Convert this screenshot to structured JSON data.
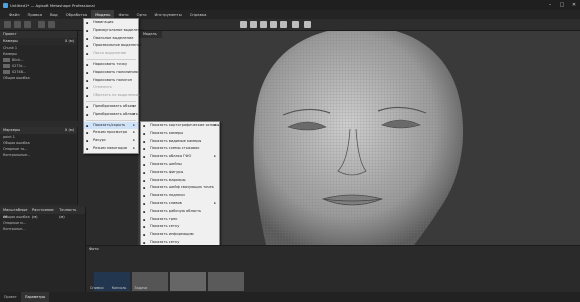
{
  "window": {
    "title": "Untitled1* — Agisoft Metashape Professional"
  },
  "menubar": [
    "Файл",
    "Правка",
    "Вид",
    "Обработка",
    "Модель",
    "Фото",
    "Орто",
    "Инструменты",
    "Справка"
  ],
  "active_menu": "Модель",
  "left_panels": {
    "workspace": {
      "title": "Проект",
      "col1": "Камеры",
      "col2": "X (м)",
      "rows": [
        "Chunk 1",
        "Камеры",
        "Blink...",
        "0273c...",
        "0274B..."
      ],
      "footer": "Общая ошибка"
    },
    "markers": {
      "title": "Маркеры",
      "col2": "X (м)",
      "rows": [
        "point 1",
        "Общая ошибка",
        "Опорные то...",
        "Контрольные..."
      ]
    },
    "scalebars": {
      "col1": "Масштабные ли",
      "col2": "Расстояние (м)",
      "col3": "Точность (м)",
      "rows": [
        "Общая ошибка",
        "Опорные м...",
        "Контрольн..."
      ]
    }
  },
  "viewport": {
    "tab": "Модель"
  },
  "model_menu": {
    "items": [
      {
        "label": "Навигация",
        "type": "item"
      },
      {
        "label": "Прямоугольное выделение",
        "type": "item"
      },
      {
        "label": "Овальное выделение",
        "type": "item"
      },
      {
        "label": "Произвольное выделение",
        "type": "item"
      },
      {
        "label": "Лассо выделение",
        "type": "disabled"
      },
      {
        "type": "sep"
      },
      {
        "label": "Нарисовать точку",
        "type": "item"
      },
      {
        "label": "Нарисовать полилинию",
        "type": "item"
      },
      {
        "label": "Нарисовать полигон",
        "type": "item"
      },
      {
        "label": "Отменить",
        "type": "disabled"
      },
      {
        "label": "Обрезать по выделению",
        "type": "disabled"
      },
      {
        "type": "sep"
      },
      {
        "label": "Преобразовать объект",
        "type": "sub"
      },
      {
        "label": "Преобразовать область",
        "type": "sub"
      },
      {
        "type": "sep"
      },
      {
        "label": "Показать/скрыть",
        "type": "sub",
        "highlight": true
      },
      {
        "label": "Режим просмотра",
        "type": "sub"
      },
      {
        "label": "Ракурс",
        "type": "sub"
      },
      {
        "label": "Режим навигации",
        "type": "sub"
      }
    ]
  },
  "show_submenu": {
    "items": [
      {
        "label": "Показать картографические основы",
        "type": "sub"
      },
      {
        "label": "Показать камеры",
        "type": "item"
      },
      {
        "label": "Показать видимые камеры",
        "type": "item"
      },
      {
        "label": "Показать схемы стыковок",
        "type": "item"
      },
      {
        "label": "Показать облака ГФО",
        "type": "sub"
      },
      {
        "label": "Показать шейпы",
        "type": "item"
      },
      {
        "label": "Показать фигуры",
        "type": "item"
      },
      {
        "label": "Показать маркеры",
        "type": "item"
      },
      {
        "label": "Показать шейф связующих точек",
        "type": "item"
      },
      {
        "label": "Показать подписи",
        "type": "item"
      },
      {
        "label": "Показать сливов",
        "type": "sub"
      },
      {
        "label": "Показать рабочую область",
        "type": "item"
      },
      {
        "label": "Показать трек",
        "type": "item"
      },
      {
        "label": "Показать сетку",
        "type": "item"
      },
      {
        "label": "Показать информацию",
        "type": "item"
      },
      {
        "label": "Показать сетку",
        "type": "item"
      },
      {
        "label": "Показать выделенные блоки",
        "type": "item"
      },
      {
        "type": "sep"
      },
      {
        "label": "Показать всё",
        "type": "item"
      },
      {
        "label": "Скрыть всё",
        "type": "item"
      }
    ]
  },
  "browser": {
    "title": "Фото",
    "tabs": [
      "Снимки",
      "Консоль",
      "Задачи"
    ]
  },
  "statusbar": {
    "tabs": [
      "Проект",
      "Параметры"
    ]
  },
  "colors": {
    "menu_bg": "#f0f0f0",
    "highlight": "#cfe2f7",
    "dark": "#2b2b2b"
  }
}
